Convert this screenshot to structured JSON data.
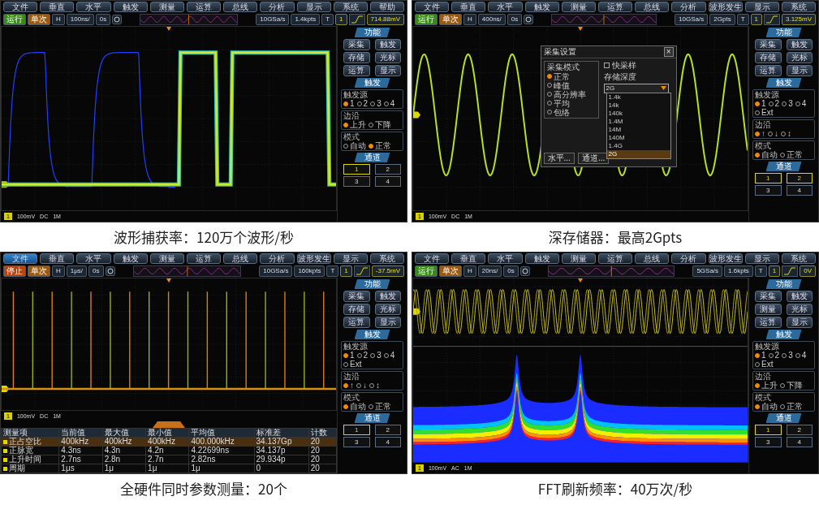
{
  "panels": [
    {
      "caption": "波形捕获率：120万个波形/秒",
      "plot": {
        "kind": "persistence"
      },
      "menu": [
        {
          "label": "文件",
          "selected": false
        },
        {
          "label": "垂直",
          "selected": false
        },
        {
          "label": "水平",
          "selected": false
        },
        {
          "label": "触发",
          "selected": false
        },
        {
          "label": "测量",
          "selected": false
        },
        {
          "label": "运算",
          "selected": false
        },
        {
          "label": "总线",
          "selected": false
        },
        {
          "label": "分析",
          "selected": false
        },
        {
          "label": "显示",
          "selected": false
        },
        {
          "label": "系统",
          "selected": false
        },
        {
          "label": "帮助",
          "selected": false
        }
      ],
      "toolbar": {
        "run": "运行",
        "running": true,
        "single": "单次",
        "h": "H",
        "timebase": "100ns/",
        "offset": "0s",
        "sample_rate": "10GSa/s",
        "depth": "1.4kpts",
        "t": "T",
        "trigger_source": "1",
        "level": "714.88mV"
      },
      "channel_bar": {
        "channel": "1",
        "scale": "100mV",
        "coupling": "DC",
        "impedance": "1M"
      },
      "sidebar": {
        "function_header": "功能",
        "function_buttons": [
          "采集",
          "触发",
          "存储",
          "光标",
          "运算",
          "显示"
        ],
        "trigger_header": "触发",
        "groups": [
          {
            "title": "触发源",
            "options": [
              {
                "label": "1",
                "selected": true
              },
              {
                "label": "2",
                "selected": false
              },
              {
                "label": "3",
                "selected": false
              },
              {
                "label": "4",
                "selected": false
              }
            ]
          },
          {
            "title": "边沿",
            "options": [
              {
                "label": "上升",
                "selected": true
              },
              {
                "label": "下降",
                "selected": false
              }
            ]
          },
          {
            "title": "模式",
            "options": [
              {
                "label": "自动",
                "selected": false
              },
              {
                "label": "正常",
                "selected": true
              }
            ]
          }
        ],
        "channel_header": "通道",
        "channels": [
          {
            "label": "1",
            "selected": true
          },
          {
            "label": "2",
            "selected": false
          },
          {
            "label": "3",
            "selected": false
          },
          {
            "label": "4",
            "selected": false
          }
        ]
      }
    },
    {
      "caption": "深存储器：最高2Gpts",
      "plot": {
        "kind": "sine"
      },
      "menu": [
        {
          "label": "文件",
          "selected": false
        },
        {
          "label": "垂直",
          "selected": false
        },
        {
          "label": "水平",
          "selected": false
        },
        {
          "label": "触发",
          "selected": false
        },
        {
          "label": "测量",
          "selected": false
        },
        {
          "label": "运算",
          "selected": false
        },
        {
          "label": "总线",
          "selected": false
        },
        {
          "label": "分析",
          "selected": false
        },
        {
          "label": "波形发生",
          "selected": false
        },
        {
          "label": "显示",
          "selected": false
        },
        {
          "label": "系统",
          "selected": false
        }
      ],
      "toolbar": {
        "run": "运行",
        "running": true,
        "single": "单次",
        "h": "H",
        "timebase": "400ns/",
        "offset": "0s",
        "sample_rate": "10GSa/s",
        "depth": "2Gpts",
        "t": "T",
        "trigger_source": "1",
        "level": "3.125mV"
      },
      "channel_bar": {
        "channel": "1",
        "scale": "100mV",
        "coupling": "DC",
        "impedance": "1M"
      },
      "dialog": {
        "title": "采集设置",
        "close": "×",
        "mode_title": "采集模式",
        "modes": [
          {
            "label": "正常",
            "selected": true
          },
          {
            "label": "峰值",
            "selected": false
          },
          {
            "label": "高分辨率",
            "selected": false
          },
          {
            "label": "平均",
            "selected": false
          },
          {
            "label": "包络",
            "selected": false
          }
        ],
        "fast": {
          "label": "快采样",
          "checked": false
        },
        "depth_label": "存储深度",
        "depth_value": "2G",
        "depth_options": [
          {
            "label": "1.4k",
            "selected": false
          },
          {
            "label": "14k",
            "selected": false
          },
          {
            "label": "140k",
            "selected": false
          },
          {
            "label": "1.4M",
            "selected": false
          },
          {
            "label": "14M",
            "selected": false
          },
          {
            "label": "140M",
            "selected": false
          },
          {
            "label": "1.4G",
            "selected": false
          },
          {
            "label": "2G",
            "selected": true
          }
        ],
        "buttons": [
          "水平...",
          "通道..."
        ]
      },
      "sidebar": {
        "function_header": "功能",
        "function_buttons": [
          "采集",
          "触发",
          "存储",
          "光标",
          "运算",
          "显示"
        ],
        "trigger_header": "触发",
        "groups": [
          {
            "title": "触发源",
            "options": [
              {
                "label": "1",
                "selected": true
              },
              {
                "label": "2",
                "selected": false
              },
              {
                "label": "3",
                "selected": false
              },
              {
                "label": "4",
                "selected": false
              },
              {
                "label": "Ext",
                "selected": false
              }
            ]
          },
          {
            "title": "边沿",
            "options": [
              {
                "label": "↑",
                "selected": true
              },
              {
                "label": "↓",
                "selected": false
              },
              {
                "label": "↕",
                "selected": false
              }
            ]
          },
          {
            "title": "模式",
            "options": [
              {
                "label": "自动",
                "selected": true
              },
              {
                "label": "正常",
                "selected": false
              }
            ]
          }
        ],
        "channel_header": "通道",
        "channels": [
          {
            "label": "1",
            "selected": true
          },
          {
            "label": "2",
            "selected": true
          },
          {
            "label": "3",
            "selected": false
          },
          {
            "label": "4",
            "selected": false
          }
        ]
      }
    },
    {
      "caption": "全硬件同时参数测量：20个",
      "plot": {
        "kind": "pulses"
      },
      "menu": [
        {
          "label": "文件",
          "selected": true
        },
        {
          "label": "垂直",
          "selected": false
        },
        {
          "label": "水平",
          "selected": false
        },
        {
          "label": "触发",
          "selected": false
        },
        {
          "label": "测量",
          "selected": false
        },
        {
          "label": "运算",
          "selected": false
        },
        {
          "label": "总线",
          "selected": false
        },
        {
          "label": "分析",
          "selected": false
        },
        {
          "label": "波形发生",
          "selected": false
        },
        {
          "label": "显示",
          "selected": false
        },
        {
          "label": "系统",
          "selected": false
        }
      ],
      "toolbar": {
        "run": "停止",
        "running": false,
        "single": "单次",
        "h": "H",
        "timebase": "1μs/",
        "offset": "0s",
        "sample_rate": "10GSa/s",
        "depth": "160kpts",
        "t": "T",
        "trigger_source": "1",
        "level": "-37.5mV"
      },
      "channel_bar": {
        "channel": "1",
        "scale": "100mV",
        "coupling": "DC",
        "impedance": "1M"
      },
      "measurements": {
        "columns": [
          "测量项",
          "当前值",
          "最大值",
          "最小值",
          "平均值",
          "标准差",
          "计数"
        ],
        "rows": [
          {
            "selected": true,
            "cells": [
              "正占空比",
              "400kHz",
              "400kHz",
              "400kHz",
              "400.000kHz",
              "34.137Gp",
              "20"
            ]
          },
          {
            "selected": false,
            "cells": [
              "正脉宽",
              "4.3ns",
              "4.3n",
              "4.2n",
              "4.22699ns",
              "34.137p",
              "20"
            ]
          },
          {
            "selected": false,
            "cells": [
              "上升时间",
              "2.7ns",
              "2.8n",
              "2.7n",
              "2.82ns",
              "29.934p",
              "20"
            ]
          },
          {
            "selected": false,
            "cells": [
              "周期",
              "1μs",
              "1μ",
              "1μ",
              "1μ",
              "0",
              "20"
            ]
          }
        ]
      },
      "sidebar": {
        "function_header": "功能",
        "function_buttons": [
          "采集",
          "触发",
          "存储",
          "光标",
          "运算",
          "显示"
        ],
        "trigger_header": "触发",
        "groups": [
          {
            "title": "触发源",
            "options": [
              {
                "label": "1",
                "selected": true
              },
              {
                "label": "2",
                "selected": false
              },
              {
                "label": "3",
                "selected": false
              },
              {
                "label": "4",
                "selected": false
              },
              {
                "label": "Ext",
                "selected": false
              }
            ]
          },
          {
            "title": "边沿",
            "options": [
              {
                "label": "↑",
                "selected": true
              },
              {
                "label": "↓",
                "selected": false
              },
              {
                "label": "↕",
                "selected": false
              }
            ]
          },
          {
            "title": "模式",
            "options": [
              {
                "label": "自动",
                "selected": true
              },
              {
                "label": "正常",
                "selected": false
              }
            ]
          }
        ],
        "channel_header": "通道",
        "channels": [
          {
            "label": "1",
            "selected": true
          },
          {
            "label": "2",
            "selected": false
          },
          {
            "label": "3",
            "selected": false
          },
          {
            "label": "4",
            "selected": false
          }
        ]
      }
    },
    {
      "caption": "FFT刷新频率：40万次/秒",
      "plot": {
        "kind": "fft"
      },
      "menu": [
        {
          "label": "文件",
          "selected": false
        },
        {
          "label": "垂直",
          "selected": false
        },
        {
          "label": "水平",
          "selected": false
        },
        {
          "label": "触发",
          "selected": false
        },
        {
          "label": "测量",
          "selected": false
        },
        {
          "label": "运算",
          "selected": false
        },
        {
          "label": "总线",
          "selected": false
        },
        {
          "label": "分析",
          "selected": false
        },
        {
          "label": "波形发生",
          "selected": false
        },
        {
          "label": "显示",
          "selected": false
        },
        {
          "label": "系统",
          "selected": false
        }
      ],
      "toolbar": {
        "run": "运行",
        "running": true,
        "single": "单次",
        "h": "H",
        "timebase": "20ns/",
        "offset": "0s",
        "sample_rate": "5GSa/s",
        "depth": "1.6kpts",
        "t": "T",
        "trigger_source": "1",
        "level": "0V"
      },
      "channel_bar": {
        "channel": "1",
        "scale": "100mV",
        "coupling": "AC",
        "impedance": "1M"
      },
      "sidebar": {
        "function_header": "功能",
        "function_buttons": [
          "采集",
          "触发",
          "测量",
          "光标",
          "运算",
          "显示"
        ],
        "trigger_header": "触发",
        "groups": [
          {
            "title": "触发源",
            "options": [
              {
                "label": "1",
                "selected": true
              },
              {
                "label": "2",
                "selected": false
              },
              {
                "label": "3",
                "selected": false
              },
              {
                "label": "4",
                "selected": false
              },
              {
                "label": "Ext",
                "selected": false
              }
            ]
          },
          {
            "title": "边沿",
            "options": [
              {
                "label": "上升",
                "selected": true
              },
              {
                "label": "下降",
                "selected": false
              }
            ]
          },
          {
            "title": "模式",
            "options": [
              {
                "label": "自动",
                "selected": true
              },
              {
                "label": "正常",
                "selected": false
              }
            ]
          }
        ],
        "channel_header": "通道",
        "channels": [
          {
            "label": "1",
            "selected": true
          },
          {
            "label": "2",
            "selected": false
          },
          {
            "label": "3",
            "selected": false
          },
          {
            "label": "4",
            "selected": false
          }
        ]
      }
    }
  ]
}
